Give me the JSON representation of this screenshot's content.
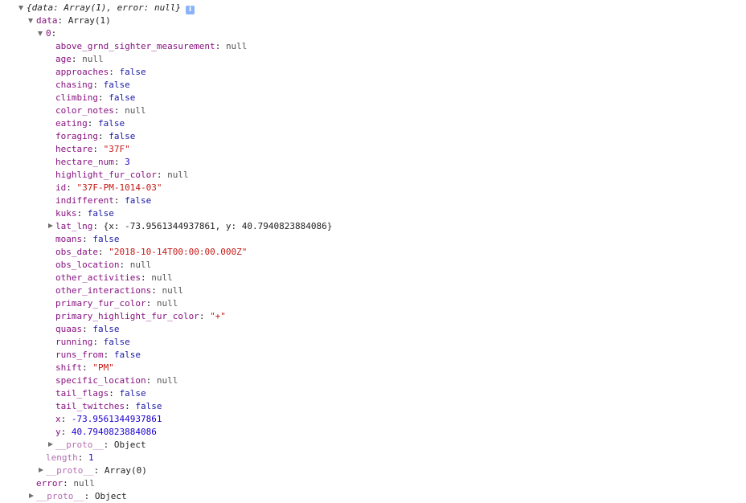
{
  "root": {
    "summary": "{data: Array(1), error: null}",
    "info_icon_glyph": "i"
  },
  "data_node": {
    "key": "data",
    "value": "Array(1)"
  },
  "item0": {
    "key": "0"
  },
  "fields": [
    {
      "key": "above_grnd_sighter_measurement",
      "value": "null",
      "type": "null"
    },
    {
      "key": "age",
      "value": "null",
      "type": "null"
    },
    {
      "key": "approaches",
      "value": "false",
      "type": "bool"
    },
    {
      "key": "chasing",
      "value": "false",
      "type": "bool"
    },
    {
      "key": "climbing",
      "value": "false",
      "type": "bool"
    },
    {
      "key": "color_notes",
      "value": "null",
      "type": "null"
    },
    {
      "key": "eating",
      "value": "false",
      "type": "bool"
    },
    {
      "key": "foraging",
      "value": "false",
      "type": "bool"
    },
    {
      "key": "hectare",
      "value": "\"37F\"",
      "type": "str"
    },
    {
      "key": "hectare_num",
      "value": "3",
      "type": "num"
    },
    {
      "key": "highlight_fur_color",
      "value": "null",
      "type": "null"
    },
    {
      "key": "id",
      "value": "\"37F-PM-1014-03\"",
      "type": "str"
    },
    {
      "key": "indifferent",
      "value": "false",
      "type": "bool"
    },
    {
      "key": "kuks",
      "value": "false",
      "type": "bool"
    },
    {
      "key": "lat_lng",
      "value": "{x: -73.9561344937861, y: 40.7940823884086}",
      "type": "obj",
      "expandable": true
    },
    {
      "key": "moans",
      "value": "false",
      "type": "bool"
    },
    {
      "key": "obs_date",
      "value": "\"2018-10-14T00:00:00.000Z\"",
      "type": "str"
    },
    {
      "key": "obs_location",
      "value": "null",
      "type": "null"
    },
    {
      "key": "other_activities",
      "value": "null",
      "type": "null"
    },
    {
      "key": "other_interactions",
      "value": "null",
      "type": "null"
    },
    {
      "key": "primary_fur_color",
      "value": "null",
      "type": "null"
    },
    {
      "key": "primary_highlight_fur_color",
      "value": "\"+\"",
      "type": "str"
    },
    {
      "key": "quaas",
      "value": "false",
      "type": "bool"
    },
    {
      "key": "running",
      "value": "false",
      "type": "bool"
    },
    {
      "key": "runs_from",
      "value": "false",
      "type": "bool"
    },
    {
      "key": "shift",
      "value": "\"PM\"",
      "type": "str"
    },
    {
      "key": "specific_location",
      "value": "null",
      "type": "null"
    },
    {
      "key": "tail_flags",
      "value": "false",
      "type": "bool"
    },
    {
      "key": "tail_twitches",
      "value": "false",
      "type": "bool"
    },
    {
      "key": "x",
      "value": "-73.9561344937861",
      "type": "num"
    },
    {
      "key": "y",
      "value": "40.7940823884086",
      "type": "num"
    }
  ],
  "item0_proto": {
    "key": "__proto__",
    "value": "Object"
  },
  "length_node": {
    "key": "length",
    "value": "1"
  },
  "data_proto": {
    "key": "__proto__",
    "value": "Array(0)"
  },
  "error_node": {
    "key": "error",
    "value": "null"
  },
  "root_proto": {
    "key": "__proto__",
    "value": "Object"
  }
}
